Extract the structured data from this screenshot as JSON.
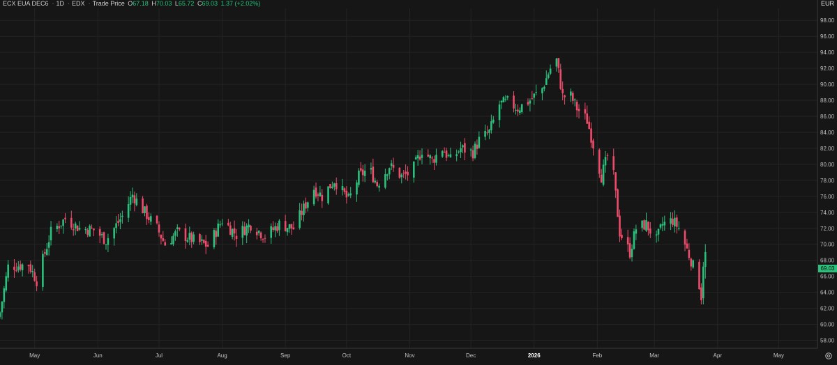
{
  "legend": {
    "symbol": "ECX EUA DEC6",
    "interval": "1D",
    "exchange": "EDX",
    "price_type": "Trade Price",
    "o_label": "O",
    "open": "67.18",
    "h_label": "H",
    "high": "70.03",
    "l_label": "L",
    "low": "65.72",
    "c_label": "C",
    "close": "69.03",
    "change": "1.37 (+2.02%)"
  },
  "currency": "EUR",
  "last_price": "69.03",
  "colors": {
    "up": "#29c17c",
    "down": "#f04b6a",
    "background": "#161616",
    "grid": "#242424",
    "axis": "#3a3a3a"
  },
  "icons": {
    "settings": "settings-gear-icon"
  },
  "chart_data": {
    "type": "candlestick",
    "y_axis": {
      "min": 57,
      "max": 99.5,
      "position": "right",
      "ticks": [
        "58.00",
        "60.00",
        "62.00",
        "64.00",
        "66.00",
        "68.00",
        "70.00",
        "72.00",
        "74.00",
        "76.00",
        "78.00",
        "80.00",
        "82.00",
        "84.00",
        "86.00",
        "88.00",
        "90.00",
        "92.00",
        "94.00",
        "96.00",
        "98.00"
      ]
    },
    "x_axis": {
      "start": "2025-04-14",
      "end": "2026-05-20",
      "ticks": [
        {
          "label": "May",
          "date": "2025-05-01"
        },
        {
          "label": "Jun",
          "date": "2025-06-01"
        },
        {
          "label": "Jul",
          "date": "2025-07-01"
        },
        {
          "label": "Aug",
          "date": "2025-08-01"
        },
        {
          "label": "Sep",
          "date": "2025-09-01"
        },
        {
          "label": "Oct",
          "date": "2025-10-01"
        },
        {
          "label": "Nov",
          "date": "2025-11-01"
        },
        {
          "label": "Dec",
          "date": "2025-12-01"
        },
        {
          "label": "2026",
          "date": "2026-01-01",
          "bold": true
        },
        {
          "label": "Feb",
          "date": "2026-02-01"
        },
        {
          "label": "Mar",
          "date": "2026-03-01"
        },
        {
          "label": "Apr",
          "date": "2026-04-01"
        },
        {
          "label": "May",
          "date": "2026-05-01"
        }
      ]
    },
    "close_anchors": [
      [
        "2025-04-14",
        61.5
      ],
      [
        "2025-04-18",
        67.2
      ],
      [
        "2025-04-28",
        67.5
      ],
      [
        "2025-05-02",
        65.5
      ],
      [
        "2025-05-09",
        71.5
      ],
      [
        "2025-05-16",
        73.2
      ],
      [
        "2025-05-23",
        72.0
      ],
      [
        "2025-05-30",
        71.8
      ],
      [
        "2025-06-05",
        70.5
      ],
      [
        "2025-06-13",
        73.5
      ],
      [
        "2025-06-18",
        76.2
      ],
      [
        "2025-06-24",
        74.0
      ],
      [
        "2025-06-30",
        72.0
      ],
      [
        "2025-07-04",
        70.0
      ],
      [
        "2025-07-10",
        71.5
      ],
      [
        "2025-07-18",
        70.5
      ],
      [
        "2025-07-25",
        69.8
      ],
      [
        "2025-08-01",
        73.0
      ],
      [
        "2025-08-08",
        71.2
      ],
      [
        "2025-08-15",
        72.5
      ],
      [
        "2025-08-22",
        71.0
      ],
      [
        "2025-08-29",
        72.5
      ],
      [
        "2025-09-05",
        72.0
      ],
      [
        "2025-09-10",
        74.5
      ],
      [
        "2025-09-15",
        77.0
      ],
      [
        "2025-09-19",
        76.0
      ],
      [
        "2025-09-25",
        78.0
      ],
      [
        "2025-10-02",
        75.5
      ],
      [
        "2025-10-07",
        78.5
      ],
      [
        "2025-10-12",
        79.5
      ],
      [
        "2025-10-16",
        77.5
      ],
      [
        "2025-10-22",
        79.8
      ],
      [
        "2025-10-28",
        78.5
      ],
      [
        "2025-11-02",
        79.0
      ],
      [
        "2025-11-07",
        81.8
      ],
      [
        "2025-11-12",
        80.5
      ],
      [
        "2025-11-17",
        82.0
      ],
      [
        "2025-11-21",
        80.5
      ],
      [
        "2025-11-26",
        82.0
      ],
      [
        "2025-12-02",
        81.5
      ],
      [
        "2025-12-05",
        83.0
      ],
      [
        "2025-12-10",
        84.0
      ],
      [
        "2025-12-15",
        87.5
      ],
      [
        "2025-12-19",
        87.8
      ],
      [
        "2025-12-24",
        87.0
      ],
      [
        "2025-12-30",
        88.0
      ],
      [
        "2026-01-05",
        89.5
      ],
      [
        "2026-01-09",
        92.0
      ],
      [
        "2026-01-12",
        93.0
      ],
      [
        "2026-01-15",
        88.5
      ],
      [
        "2026-01-19",
        88.5
      ],
      [
        "2026-01-22",
        87.0
      ],
      [
        "2026-01-27",
        85.5
      ],
      [
        "2026-01-30",
        82.5
      ],
      [
        "2026-02-03",
        78.5
      ],
      [
        "2026-02-06",
        81.0
      ],
      [
        "2026-02-09",
        78.5
      ],
      [
        "2026-02-12",
        71.5
      ],
      [
        "2026-02-17",
        69.0
      ],
      [
        "2026-02-20",
        72.0
      ],
      [
        "2026-02-25",
        72.5
      ],
      [
        "2026-03-02",
        70.5
      ],
      [
        "2026-03-05",
        72.5
      ],
      [
        "2026-03-10",
        73.0
      ],
      [
        "2026-03-13",
        72.0
      ],
      [
        "2026-03-16",
        70.0
      ],
      [
        "2026-03-19",
        68.0
      ],
      [
        "2026-03-23",
        65.0
      ],
      [
        "2026-03-24",
        63.5
      ],
      [
        "2026-03-25",
        67.7
      ],
      [
        "2026-03-26",
        69.03
      ]
    ]
  }
}
